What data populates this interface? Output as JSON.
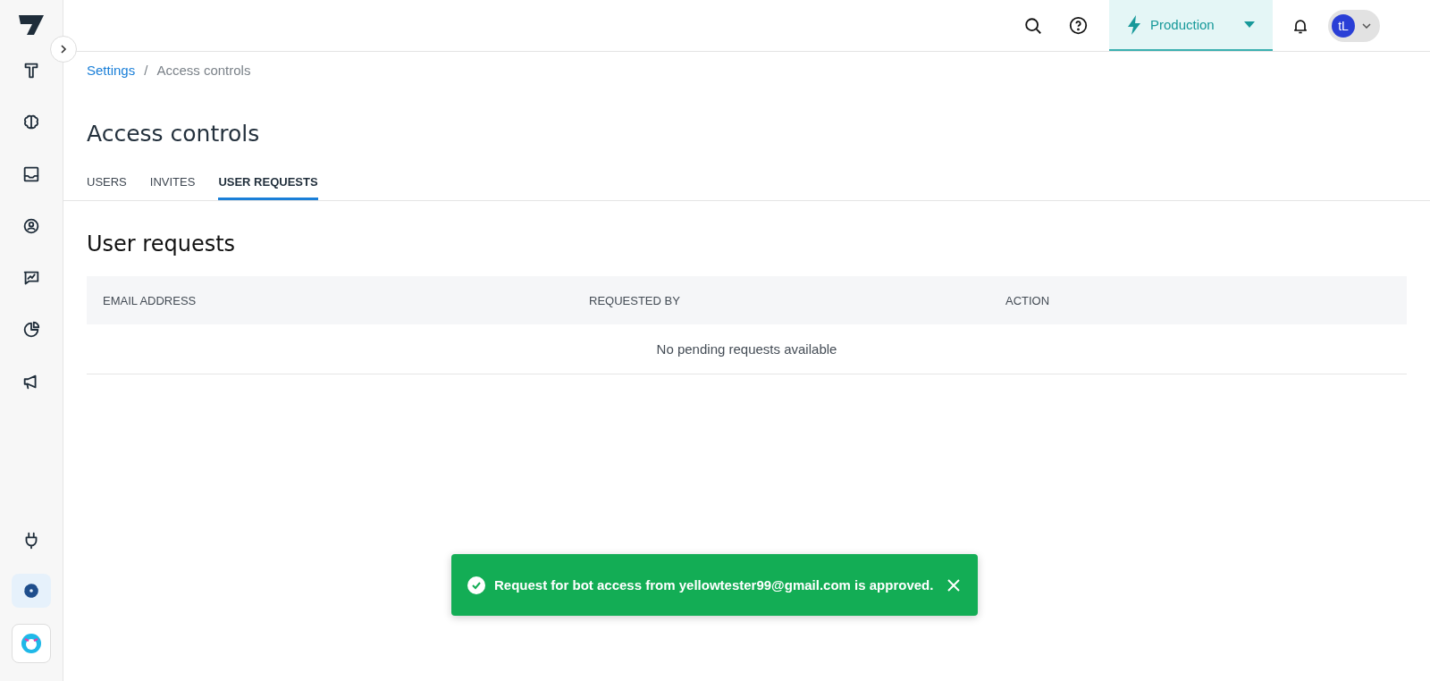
{
  "sidebar": {
    "top_items": [
      {
        "kind": "pen",
        "selected": false
      },
      {
        "kind": "brain",
        "selected": false
      },
      {
        "kind": "inbox",
        "selected": false
      },
      {
        "kind": "user",
        "selected": false
      },
      {
        "kind": "chart",
        "selected": false
      },
      {
        "kind": "pie",
        "selected": false
      },
      {
        "kind": "megaphone",
        "selected": false
      }
    ],
    "bottom_items": [
      {
        "kind": "plug",
        "selected": false
      },
      {
        "kind": "gear",
        "selected": true
      }
    ]
  },
  "topbar": {
    "environment": "Production",
    "avatar": "tL"
  },
  "breadcrumb": {
    "link": "Settings",
    "separator": "/",
    "current": "Access controls"
  },
  "title": "Access controls",
  "tabs": [
    {
      "label": "USERS",
      "selected": false
    },
    {
      "label": "INVITES",
      "selected": false
    },
    {
      "label": "USER REQUESTS",
      "selected": true
    }
  ],
  "section_title": "User requests",
  "table": {
    "columns": [
      "EMAIL ADDRESS",
      "REQUESTED BY",
      "ACTION"
    ],
    "empty_message": "No pending requests available"
  },
  "toast": {
    "message": "Request for bot access from yellowtester99@gmail.com is approved."
  }
}
